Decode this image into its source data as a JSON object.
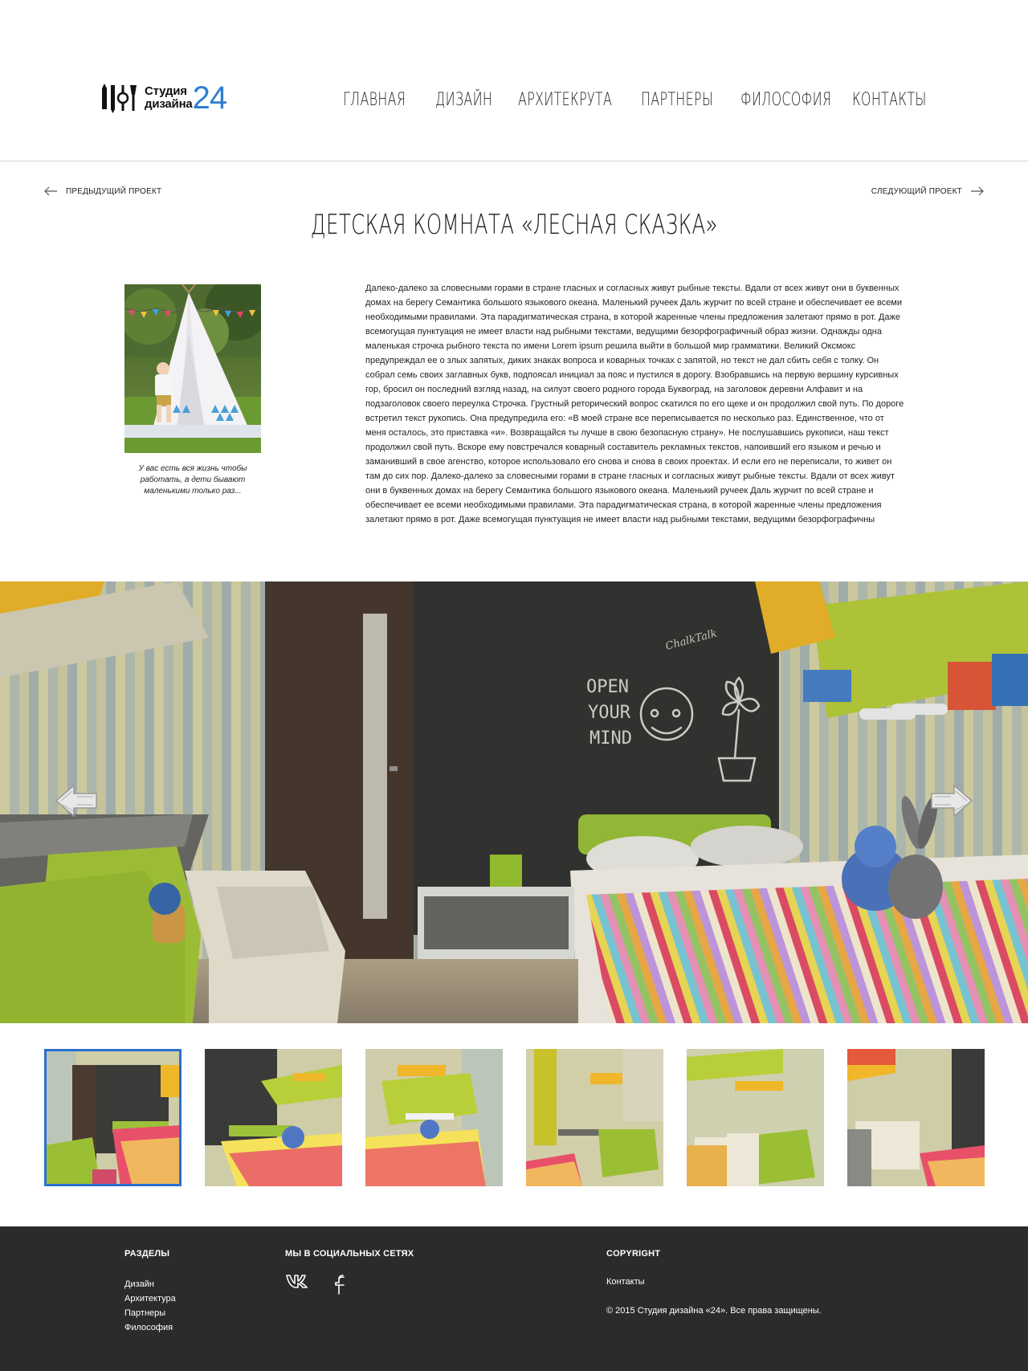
{
  "header": {
    "logo": {
      "line1": "Студия",
      "line2": "дизайна",
      "number": "24"
    },
    "nav": [
      "Главная",
      "Дизайн",
      "Архитекрута",
      "Партнеры",
      "Философия",
      "Контакты"
    ]
  },
  "project_nav": {
    "prev": "Предыдущий проект",
    "next": "Следующий проект"
  },
  "title": "Детская комната «Лесная сказка»",
  "intro": {
    "caption": "У вас есть вся жизнь чтобы работать, а дети бывают маленькими только раз...",
    "text": "Далеко-далеко за словесными горами в стране гласных и согласных живут рыбные тексты. Вдали от всех живут они в буквенных домах на берегу Семантика большого языкового океана. Маленький ручеек Даль журчит по всей стране и обеспечивает ее всеми необходимыми правилами. Эта парадигматическая страна, в которой жаренные члены предложения залетают прямо в рот. Даже всемогущая пунктуация не имеет власти над рыбными текстами, ведущими безорфографичный образ жизни. Однажды одна маленькая строчка рыбного текста по имени Lorem ipsum решила выйти в большой мир грамматики. Великий Оксмокс предупреждал ее о злых запятых, диких знаках вопроса и коварных точках с запятой, но текст не дал сбить себя с толку. Он собрал семь своих заглавных букв, подпоясал инициал за пояс и пустился в дорогу. Взобравшись на первую вершину курсивных гор, бросил он последний взгляд назад, на силуэт своего родного города Буквоград, на заголовок деревни Алфавит и на подзаголовок своего переулка Строчка. Грустный реторический вопрос скатился по его щеке и он продолжил свой путь. По дороге встретил текст рукопись. Она предупредила его: «В моей стране все переписывается по несколько раз. Единственное, что от меня осталось, это приставка «и». Возвращайся ты лучше в свою безопасную страну». Не послушавшись рукописи, наш текст продолжил свой путь. Вскоре ему повстречался коварный составитель рекламных текстов, напоивший его языком и речью и заманивший в свое агенство, которое использовало его снова и снова в своих проектах. И если его не переписали, то живет он там до сих пор. Далеко-далеко за словесными горами в стране гласных и согласных живут рыбные тексты. Вдали от всех живут они в буквенных домах на берегу Семантика большого языкового океана. Маленький ручеек Даль журчит по всей стране и обеспечивает ее всеми необходимыми правилами. Эта парадигматическая страна, в которой жаренные члены предложения залетают прямо в рот. Даже всемогущая пунктуация не имеет власти над рыбными текстами, ведущими безорфографичны"
  },
  "slider": {
    "chalk_text": [
      "OPEN",
      "YOUR",
      "MIND"
    ],
    "chalk_sign": "ChalkTalk"
  },
  "thumbnails": {
    "count": 6,
    "active_index": 0
  },
  "footer": {
    "sections_heading": "Разделы",
    "sections": [
      "Дизайн",
      "Архитектура",
      "Партнеры",
      "Философия"
    ],
    "social_heading": "Мы в социальных сетях",
    "copyright_heading": "Copyright",
    "contacts_link": "Контакты",
    "copyright_text": "© 2015 Студия дизайна «24». Все права защищены."
  },
  "colors": {
    "accent": "#2d7fd1",
    "footer_bg": "#2b2b2b",
    "thumb_active": "#2a6fd0"
  }
}
